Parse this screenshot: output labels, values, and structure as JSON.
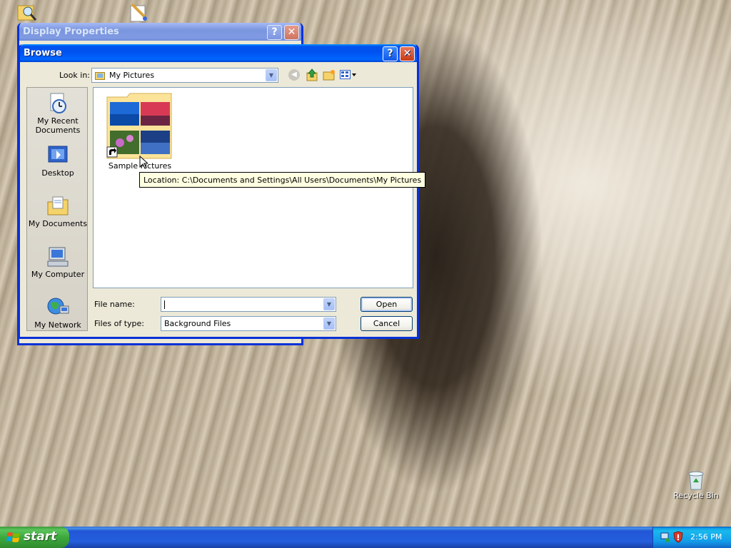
{
  "desktop": {
    "recycle_bin_label": "Recycle Bin"
  },
  "display_properties": {
    "title": "Display Properties",
    "help_label": "?",
    "close_label": "✕"
  },
  "browse": {
    "title": "Browse",
    "help_label": "?",
    "close_label": "✕",
    "look_in_label": "Look in:",
    "look_in_value": "My Pictures",
    "places": [
      {
        "label_line1": "My Recent",
        "label_line2": "Documents",
        "icon": "recent-documents-icon"
      },
      {
        "label_line1": "Desktop",
        "icon": "desktop-icon"
      },
      {
        "label_line1": "My Documents",
        "icon": "my-documents-icon"
      },
      {
        "label_line1": "My Computer",
        "icon": "my-computer-icon"
      },
      {
        "label_line1": "My Network",
        "icon": "my-network-icon"
      }
    ],
    "files": [
      {
        "name": "Sample Pictures",
        "icon": "folder-shortcut-icon"
      }
    ],
    "tooltip": "Location: C:\\Documents and Settings\\All Users\\Documents\\My Pictures",
    "file_name_label": "File name:",
    "file_name_value": "",
    "files_of_type_label": "Files of type:",
    "files_of_type_value": "Background Files",
    "open_label": "Open",
    "cancel_label": "Cancel"
  },
  "taskbar": {
    "start_label": "start",
    "clock": "2:56 PM"
  }
}
